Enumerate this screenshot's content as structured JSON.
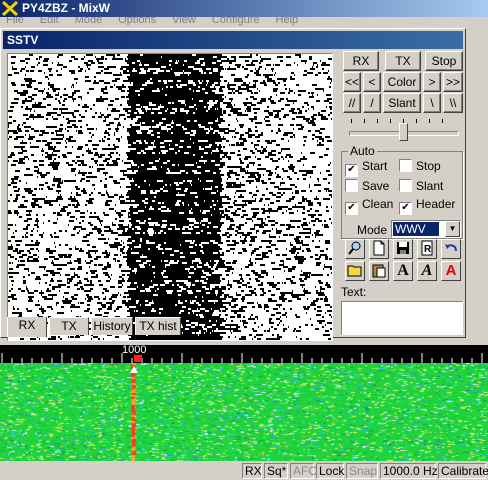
{
  "window": {
    "title": "PY4ZBZ - MixW"
  },
  "menu": [
    "File",
    "Edit",
    "Mode",
    "Options",
    "View",
    "Configure",
    "Help"
  ],
  "sstv": {
    "title": "SSTV",
    "controls": {
      "rx": "RX",
      "tx": "TX",
      "stop": "Stop",
      "shift_ll": "<<",
      "shift_l": "<",
      "color": "Color",
      "shift_r": ">",
      "shift_rr": ">>",
      "slant_ll": "//",
      "slant_l": "/",
      "slant": "Slant",
      "slant_r": "\\",
      "slant_rr": "\\\\"
    },
    "slider_level": 0.5,
    "auto": {
      "legend": "Auto",
      "start": {
        "label": "Start",
        "checked": true
      },
      "stop": {
        "label": "Stop",
        "checked": false
      },
      "save": {
        "label": "Save",
        "checked": false
      },
      "slant": {
        "label": "Slant",
        "checked": false
      },
      "clean": {
        "label": "Clean",
        "checked": true
      },
      "header": {
        "label": "Header",
        "checked": true
      }
    },
    "mode": {
      "label": "Mode",
      "value": "WWV"
    },
    "text": {
      "label": "Text:",
      "value": ""
    },
    "tabs": [
      "RX",
      "TX",
      "History",
      "TX hist"
    ]
  },
  "waterfall": {
    "marker_freq": "1000",
    "colors": {
      "background": "#1fd43a",
      "signal": "#ff3b1f"
    }
  },
  "status": {
    "rx": "RX",
    "sq": "Sq*",
    "afc": "AFC",
    "lock": "Lock",
    "snap": "Snap",
    "freq": "1000.0 Hz",
    "calibrate": "Calibrate"
  }
}
